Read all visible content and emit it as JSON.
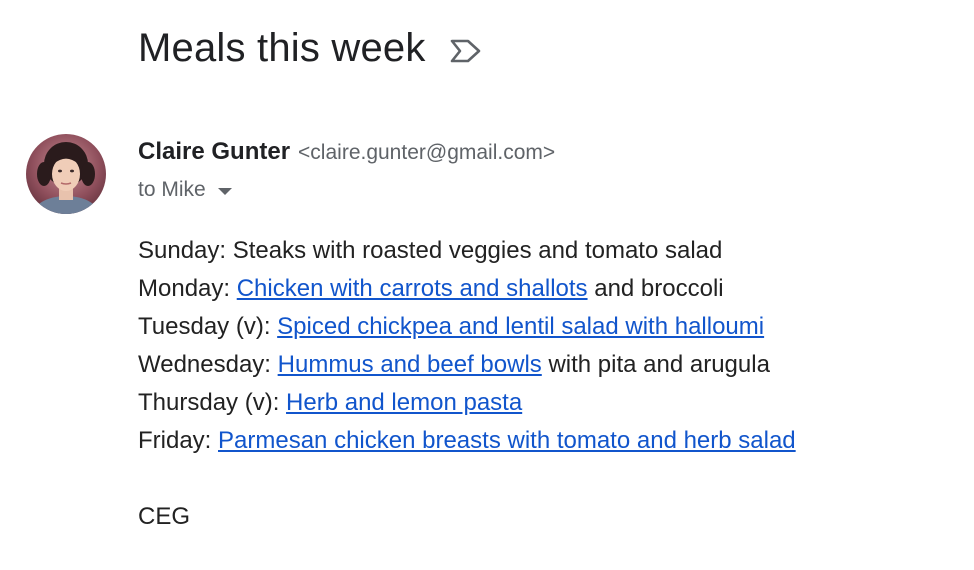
{
  "email": {
    "subject": "Meals this week",
    "label_icon": "label-arrow-icon",
    "sender": {
      "name": "Claire Gunter",
      "email": "<claire.gunter@gmail.com>",
      "avatar": "avatar-photo"
    },
    "recipient_text": "to Mike",
    "recipient_toggle_icon": "chevron-down-icon",
    "body": {
      "sunday": {
        "prefix": "Sunday: ",
        "text": "Steaks with roasted veggies and tomato salad"
      },
      "monday": {
        "prefix": "Monday: ",
        "link": "Chicken with carrots and shallots",
        "suffix": " and broccoli"
      },
      "tuesday": {
        "prefix": "Tuesday (v): ",
        "link": "Spiced chickpea and lentil salad with halloumi"
      },
      "wednesday": {
        "prefix": "Wednesday: ",
        "link": "Hummus and beef bowls",
        "suffix": " with pita and arugula"
      },
      "thursday": {
        "prefix": "Thursday (v): ",
        "link": "Herb and lemon pasta"
      },
      "friday": {
        "prefix": "Friday: ",
        "link": "Parmesan chicken breasts with tomato and herb salad"
      },
      "signature": "CEG"
    },
    "colors": {
      "link": "#1155cc",
      "text": "#202124",
      "muted": "#5f6368"
    }
  }
}
